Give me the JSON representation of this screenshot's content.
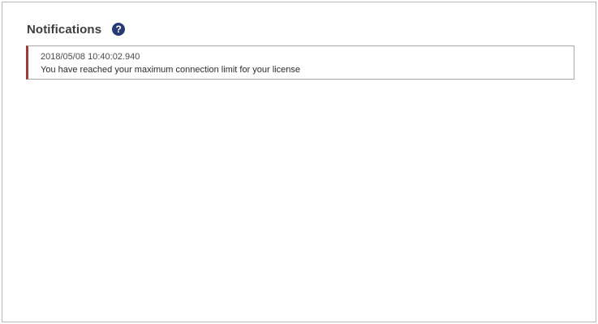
{
  "header": {
    "title": "Notifications",
    "help_icon": "question-circle-icon",
    "help_glyph": "?"
  },
  "notifications": [
    {
      "timestamp": "2018/05/08 10:40:02.940",
      "message": "You have reached your maximum connection limit for your license",
      "severity_color": "#9d3b38"
    }
  ],
  "colors": {
    "help_icon_bg": "#283a73",
    "border": "#a8a8a8"
  }
}
